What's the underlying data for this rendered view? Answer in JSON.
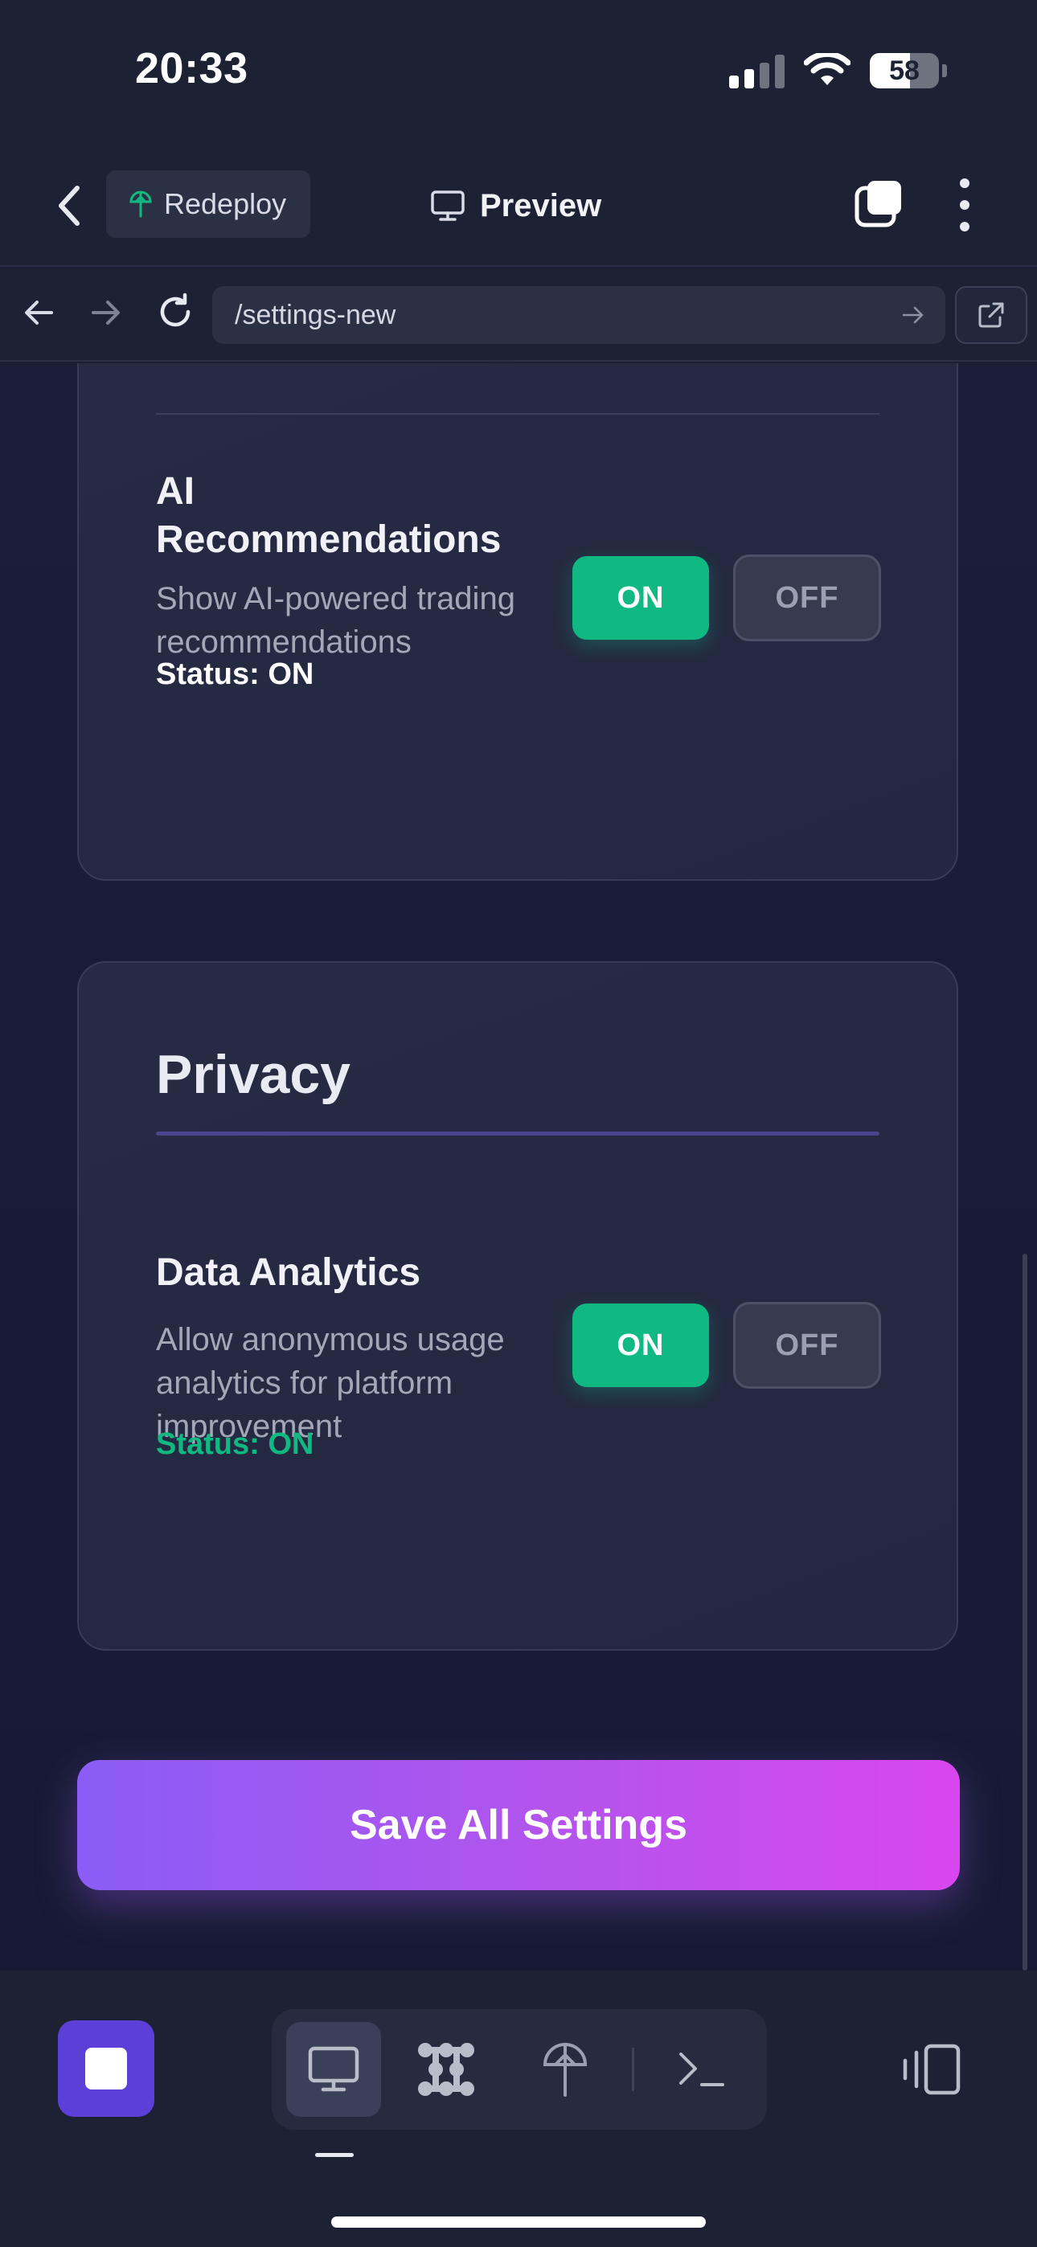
{
  "status_bar": {
    "time": "20:33",
    "battery": "58"
  },
  "header": {
    "redeploy_label": "Redeploy",
    "preview_label": "Preview"
  },
  "browser": {
    "url": "/settings-new"
  },
  "ai_recommendations": {
    "title_line1": "AI",
    "title_line2": "Recommendations",
    "desc_line1": "Show AI-powered trading",
    "desc_line2": "recommendations",
    "status": "Status: ON",
    "on_label": "ON",
    "off_label": "OFF",
    "status_color": "#ffffff"
  },
  "privacy": {
    "section_title": "Privacy",
    "data_analytics": {
      "title": "Data Analytics",
      "desc_line1": "Allow anonymous usage",
      "desc_line2": "analytics for platform",
      "desc_line3": "improvement",
      "status": "Status: ON",
      "on_label": "ON",
      "off_label": "OFF",
      "status_color": "#10b981"
    }
  },
  "save_button": {
    "label": "Save All Settings"
  },
  "colors": {
    "accent_green": "#10b981",
    "save_gradient_start": "#8b5cf6",
    "save_gradient_end": "#d946ef",
    "stop_button": "#5b3fd6"
  },
  "toolbar": {
    "icons": [
      "stop-icon",
      "desktop-icon",
      "grid-blob-icon",
      "deploy-antenna-icon",
      "terminal-icon",
      "device-toggle-icon"
    ]
  }
}
